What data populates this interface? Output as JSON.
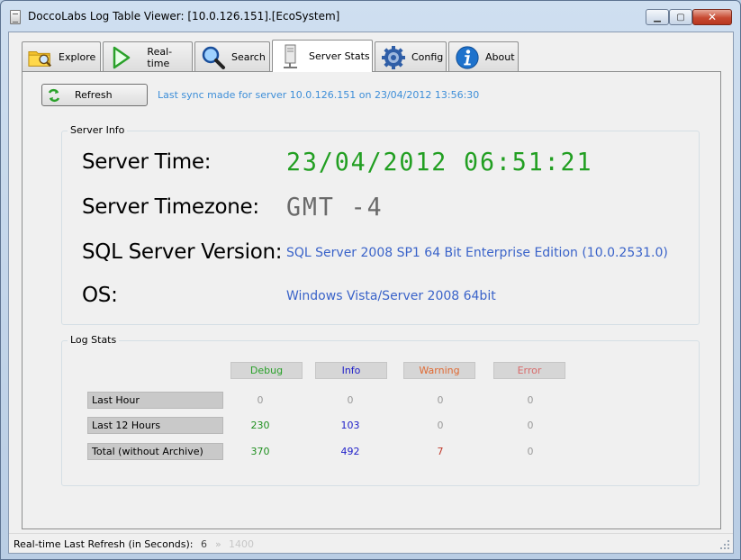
{
  "window": {
    "title": "DoccoLabs Log Table Viewer: [10.0.126.151].[EcoSystem]",
    "min_glyph": "▁",
    "max_glyph": "▢",
    "close_glyph": "✕"
  },
  "tabs": [
    {
      "label": "Explore",
      "icon": "folder-search-icon"
    },
    {
      "label": "Real-time",
      "icon": "play-icon"
    },
    {
      "label": "Search",
      "icon": "magnifier-icon"
    },
    {
      "label": "Server Stats",
      "icon": "server-icon",
      "active": true
    },
    {
      "label": "Config",
      "icon": "gear-icon"
    },
    {
      "label": "About",
      "icon": "info-icon"
    }
  ],
  "toolbar": {
    "refresh_label": "Refresh",
    "sync_text": "Last sync made for server 10.0.126.151 on 23/04/2012 13:56:30"
  },
  "server_info": {
    "group_label": "Server Info",
    "time_label": "Server Time:",
    "time_value": "23/04/2012 06:51:21",
    "timezone_label": "Server Timezone:",
    "timezone_value": "GMT -4",
    "sql_label": "SQL Server Version:",
    "sql_value": "SQL Server 2008 SP1 64 Bit Enterprise Edition (10.0.2531.0)",
    "os_label": "OS:",
    "os_value": "Windows Vista/Server 2008 64bit"
  },
  "log_stats": {
    "group_label": "Log Stats",
    "columns": [
      {
        "label": "Debug",
        "color": "#2aa12a"
      },
      {
        "label": "Info",
        "color": "#2121c9"
      },
      {
        "label": "Warning",
        "color": "#e06a33"
      },
      {
        "label": "Error",
        "color": "#d96b6b"
      }
    ],
    "rows": [
      {
        "label": "Last Hour",
        "values": [
          "0",
          "0",
          "0",
          "0"
        ],
        "colors": [
          "#9a9a9a",
          "#9a9a9a",
          "#9a9a9a",
          "#9a9a9a"
        ]
      },
      {
        "label": "Last 12 Hours",
        "values": [
          "230",
          "103",
          "0",
          "0"
        ],
        "colors": [
          "#1f8f1f",
          "#2121c9",
          "#9a9a9a",
          "#9a9a9a"
        ]
      },
      {
        "label": "Total (without Archive)",
        "values": [
          "370",
          "492",
          "7",
          "0"
        ],
        "colors": [
          "#1f8f1f",
          "#2121c9",
          "#c0392b",
          "#9a9a9a"
        ]
      }
    ]
  },
  "status": {
    "label": "Real-time Last Refresh (in Seconds):",
    "value": "6",
    "separator": "»",
    "max_value": "1400"
  }
}
